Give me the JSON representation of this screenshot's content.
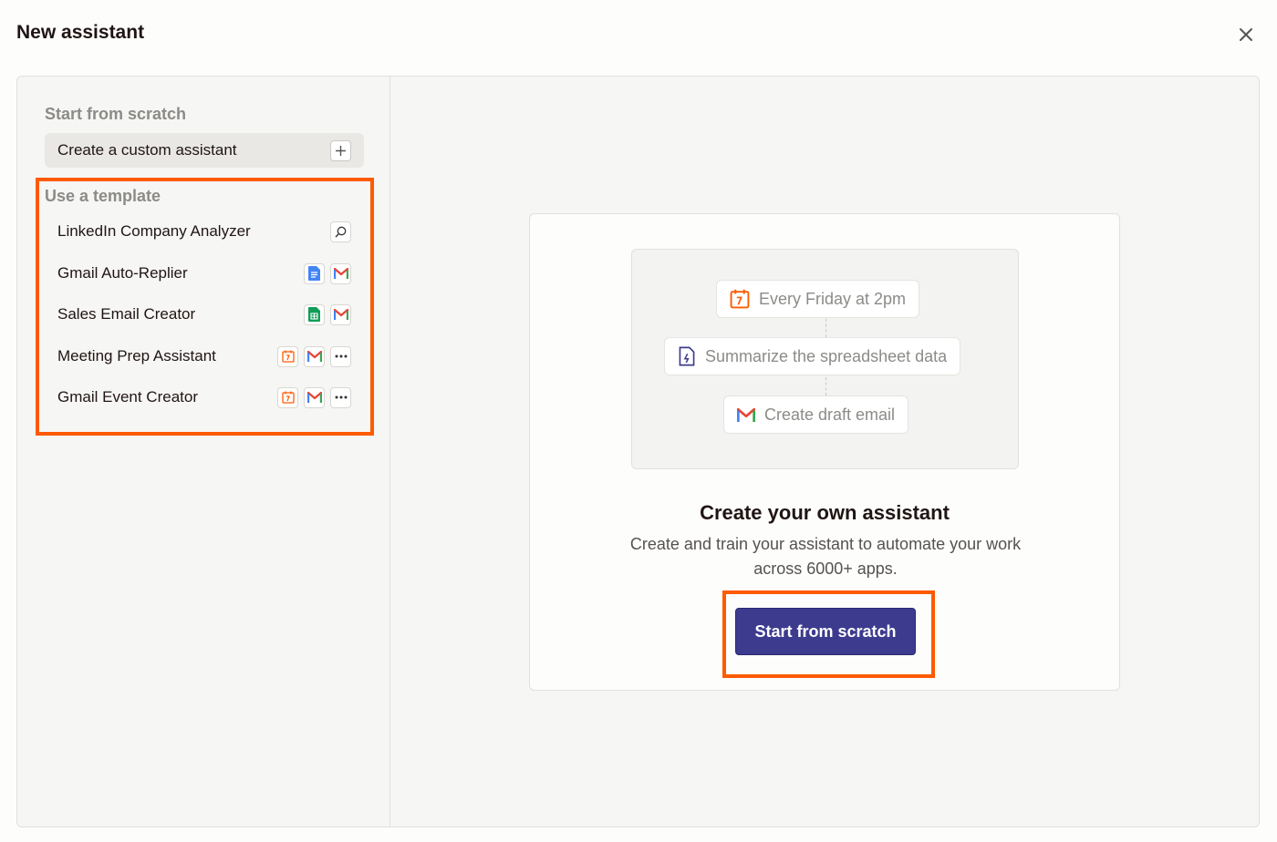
{
  "header": {
    "title": "New assistant"
  },
  "sidebar": {
    "scratch_label": "Start from scratch",
    "custom_button_label": "Create a custom assistant",
    "template_label": "Use a template",
    "templates": [
      {
        "label": "LinkedIn Company Analyzer",
        "icons": [
          "search-icon"
        ]
      },
      {
        "label": "Gmail Auto-Replier",
        "icons": [
          "google-docs-icon",
          "gmail-icon"
        ]
      },
      {
        "label": "Sales Email Creator",
        "icons": [
          "google-sheets-icon",
          "gmail-icon"
        ]
      },
      {
        "label": "Meeting Prep Assistant",
        "icons": [
          "schedule-icon",
          "gmail-icon",
          "more-icon"
        ]
      },
      {
        "label": "Gmail Event Creator",
        "icons": [
          "schedule-icon",
          "gmail-icon",
          "more-icon"
        ]
      }
    ]
  },
  "main": {
    "flow_steps": [
      {
        "label": "Every Friday at 2pm",
        "icon": "schedule-icon"
      },
      {
        "label": "Summarize the spreadsheet data",
        "icon": "ai-document-icon"
      },
      {
        "label": "Create draft email",
        "icon": "gmail-icon"
      }
    ],
    "title": "Create your own assistant",
    "description": "Create and train your assistant to automate your work across 6000+ apps.",
    "start_button_label": "Start from scratch"
  },
  "colors": {
    "highlight": "#ff5a00",
    "primary_button": "#3d3b8e",
    "schedule_orange": "#ff5a00"
  }
}
